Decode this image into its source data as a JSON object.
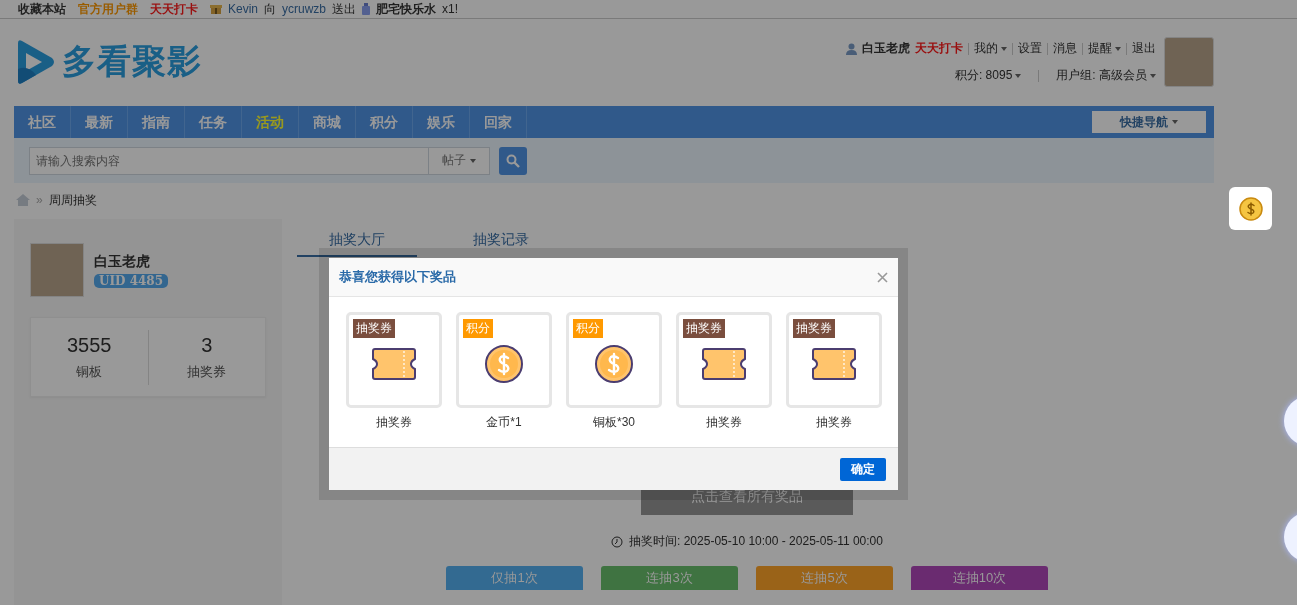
{
  "top_bar": {
    "links": [
      {
        "text": "收藏本站",
        "color": "#1f1f1f"
      },
      {
        "text": "官方用户群",
        "color": "#995c00"
      },
      {
        "text": "天天打卡",
        "color": "#991010"
      }
    ],
    "gift_sender": "Kevin",
    "gift_verb": "向",
    "gift_receiver": "ycruwzb",
    "gift_action": "送出",
    "gift_name": "肥宅快乐水",
    "gift_count": "x1!"
  },
  "header": {
    "logo_text": "多看聚影",
    "user": {
      "name": "白玉老虎",
      "checkin": "天天打卡",
      "menu": [
        {
          "label": "我的",
          "dropdown": true
        },
        {
          "label": "设置",
          "dropdown": false
        },
        {
          "label": "消息",
          "dropdown": false
        },
        {
          "label": "提醒",
          "dropdown": true
        },
        {
          "label": "退出",
          "dropdown": false
        }
      ],
      "points": "积分: 8095",
      "group": "用户组: 高级会员"
    }
  },
  "nav": {
    "items": [
      {
        "label": "社区",
        "selected": false
      },
      {
        "label": "最新",
        "selected": false
      },
      {
        "label": "指南",
        "selected": false
      },
      {
        "label": "任务",
        "selected": false
      },
      {
        "label": "活动",
        "selected": true
      },
      {
        "label": "商城",
        "selected": false
      },
      {
        "label": "积分",
        "selected": false
      },
      {
        "label": "娱乐",
        "selected": false
      },
      {
        "label": "回家",
        "selected": false
      }
    ],
    "quick_nav": "快捷导航"
  },
  "search": {
    "placeholder": "请输入搜索内容",
    "type": "帖子"
  },
  "breadcrumb": {
    "separator": "»",
    "current": "周周抽奖"
  },
  "profile": {
    "name": "白玉老虎",
    "uid": "UID 4485",
    "stats": [
      {
        "value": "3555",
        "label": "铜板"
      },
      {
        "value": "3",
        "label": "抽奖券"
      }
    ]
  },
  "tabs": [
    {
      "label": "抽奖大厅",
      "selected": true
    },
    {
      "label": "抽奖记录",
      "selected": false
    }
  ],
  "view_all_button": "点击查看所有奖品",
  "draw_time": "抽奖时间: 2025-05-10 10:00 - 2025-05-11 00:00",
  "draw_buttons": [
    {
      "label": "仅抽1次",
      "color": "#336a91"
    },
    {
      "label": "连抽3次",
      "color": "#3f7341"
    },
    {
      "label": "连抽5次",
      "color": "#9a6318"
    },
    {
      "label": "连抽10次",
      "color": "#6a2b70"
    }
  ],
  "dialog": {
    "title": "恭喜您获得以下奖品",
    "prizes": [
      {
        "tag": "抽奖券",
        "color": "#7a4e3e",
        "kind": "ticket",
        "name": "抽奖券"
      },
      {
        "tag": "积分",
        "color": "#ff9900",
        "kind": "coin",
        "name": "金币*1"
      },
      {
        "tag": "积分",
        "color": "#ff9900",
        "kind": "coin",
        "name": "铜板*30"
      },
      {
        "tag": "抽奖券",
        "color": "#7a4e3e",
        "kind": "ticket",
        "name": "抽奖券"
      },
      {
        "tag": "抽奖券",
        "color": "#7a4e3e",
        "kind": "ticket",
        "name": "抽奖券"
      }
    ],
    "confirm": "确定"
  }
}
